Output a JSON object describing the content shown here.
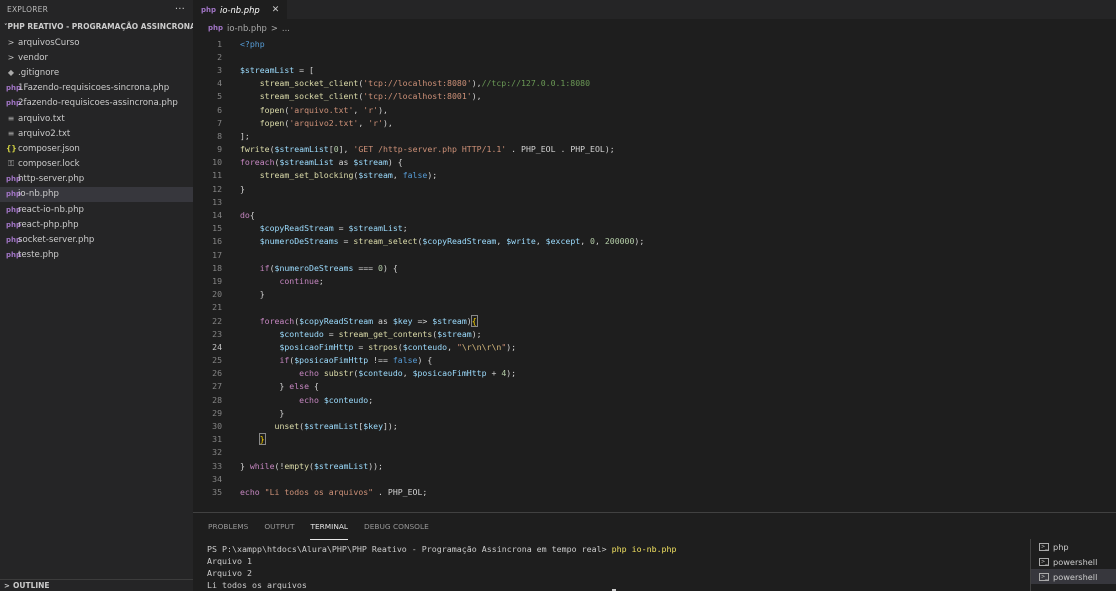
{
  "sidebar": {
    "header": "EXPLORER",
    "more_glyph": "···",
    "project": "PHP REATIVO - PROGRAMAÇÃO ASSINCRONA E...",
    "items": [
      {
        "label": "arquivosCurso",
        "icon": "chevron-right-icon",
        "glyph": ">"
      },
      {
        "label": "vendor",
        "icon": "chevron-right-icon",
        "glyph": ">"
      },
      {
        "label": ".gitignore",
        "icon": "git-file-icon",
        "glyph": "◆"
      },
      {
        "label": "1Fazendo-requisicoes-sincrona.php",
        "icon": "php-file-icon",
        "glyph": "php"
      },
      {
        "label": "2fazendo-requisicoes-assincrona.php",
        "icon": "php-file-icon",
        "glyph": "php"
      },
      {
        "label": "arquivo.txt",
        "icon": "text-file-icon",
        "glyph": "≡"
      },
      {
        "label": "arquivo2.txt",
        "icon": "text-file-icon",
        "glyph": "≡"
      },
      {
        "label": "composer.json",
        "icon": "json-file-icon",
        "glyph": "{}"
      },
      {
        "label": "composer.lock",
        "icon": "lock-file-icon",
        "glyph": "⚿"
      },
      {
        "label": "http-server.php",
        "icon": "php-file-icon",
        "glyph": "php"
      },
      {
        "label": "io-nb.php",
        "icon": "php-file-icon",
        "glyph": "php"
      },
      {
        "label": "react-io-nb.php",
        "icon": "php-file-icon",
        "glyph": "php"
      },
      {
        "label": "react-php.php",
        "icon": "php-file-icon",
        "glyph": "php"
      },
      {
        "label": "socket-server.php",
        "icon": "php-file-icon",
        "glyph": "php"
      },
      {
        "label": "teste.php",
        "icon": "php-file-icon",
        "glyph": "php"
      }
    ],
    "active_index": 10,
    "outline": "OUTLINE"
  },
  "editor": {
    "tab": {
      "label": "io-nb.php",
      "close": "✕"
    },
    "breadcrumb": {
      "file": "io-nb.php",
      "sep": ">",
      "rest": "..."
    },
    "current_line": 24,
    "lines": [
      [
        {
          "c": "t-tag",
          "t": "<?php"
        }
      ],
      [],
      [
        {
          "c": "t-var",
          "t": "$streamList"
        },
        {
          "c": "t-op",
          "t": " = ["
        }
      ],
      [
        {
          "c": "t-plain",
          "t": "    "
        },
        {
          "c": "t-fn",
          "t": "stream_socket_client"
        },
        {
          "c": "t-plain",
          "t": "("
        },
        {
          "c": "t-str",
          "t": "'tcp://localhost:8080'"
        },
        {
          "c": "t-plain",
          "t": "),"
        },
        {
          "c": "t-cm",
          "t": "//tcp://127.0.0.1:8080"
        }
      ],
      [
        {
          "c": "t-plain",
          "t": "    "
        },
        {
          "c": "t-fn",
          "t": "stream_socket_client"
        },
        {
          "c": "t-plain",
          "t": "("
        },
        {
          "c": "t-str",
          "t": "'tcp://localhost:8001'"
        },
        {
          "c": "t-plain",
          "t": "),"
        }
      ],
      [
        {
          "c": "t-plain",
          "t": "    "
        },
        {
          "c": "t-fn",
          "t": "fopen"
        },
        {
          "c": "t-plain",
          "t": "("
        },
        {
          "c": "t-str",
          "t": "'arquivo.txt'"
        },
        {
          "c": "t-plain",
          "t": ", "
        },
        {
          "c": "t-str",
          "t": "'r'"
        },
        {
          "c": "t-plain",
          "t": "),"
        }
      ],
      [
        {
          "c": "t-plain",
          "t": "    "
        },
        {
          "c": "t-fn",
          "t": "fopen"
        },
        {
          "c": "t-plain",
          "t": "("
        },
        {
          "c": "t-str",
          "t": "'arquivo2.txt'"
        },
        {
          "c": "t-plain",
          "t": ", "
        },
        {
          "c": "t-str",
          "t": "'r'"
        },
        {
          "c": "t-plain",
          "t": "),"
        }
      ],
      [
        {
          "c": "t-plain",
          "t": "];"
        }
      ],
      [
        {
          "c": "t-fn",
          "t": "fwrite"
        },
        {
          "c": "t-plain",
          "t": "("
        },
        {
          "c": "t-var",
          "t": "$streamList"
        },
        {
          "c": "t-plain",
          "t": "["
        },
        {
          "c": "t-num",
          "t": "0"
        },
        {
          "c": "t-plain",
          "t": "], "
        },
        {
          "c": "t-str",
          "t": "'GET /http-server.php HTTP/1.1'"
        },
        {
          "c": "t-plain",
          "t": " . PHP_EOL . PHP_EOL);"
        }
      ],
      [
        {
          "c": "t-kw",
          "t": "foreach"
        },
        {
          "c": "t-plain",
          "t": "("
        },
        {
          "c": "t-var",
          "t": "$streamList"
        },
        {
          "c": "t-plain",
          "t": " as "
        },
        {
          "c": "t-var",
          "t": "$stream"
        },
        {
          "c": "t-plain",
          "t": ") {"
        }
      ],
      [
        {
          "c": "t-plain",
          "t": "    "
        },
        {
          "c": "t-fn",
          "t": "stream_set_blocking"
        },
        {
          "c": "t-plain",
          "t": "("
        },
        {
          "c": "t-var",
          "t": "$stream"
        },
        {
          "c": "t-plain",
          "t": ", "
        },
        {
          "c": "t-const",
          "t": "false"
        },
        {
          "c": "t-plain",
          "t": ");"
        }
      ],
      [
        {
          "c": "t-plain",
          "t": "}"
        }
      ],
      [],
      [
        {
          "c": "t-kw",
          "t": "do"
        },
        {
          "c": "t-plain",
          "t": "{"
        }
      ],
      [
        {
          "c": "t-plain",
          "t": "    "
        },
        {
          "c": "t-var",
          "t": "$copyReadStream"
        },
        {
          "c": "t-plain",
          "t": " = "
        },
        {
          "c": "t-var",
          "t": "$streamList"
        },
        {
          "c": "t-plain",
          "t": ";"
        }
      ],
      [
        {
          "c": "t-plain",
          "t": "    "
        },
        {
          "c": "t-var",
          "t": "$numeroDeStreams"
        },
        {
          "c": "t-plain",
          "t": " = "
        },
        {
          "c": "t-fn",
          "t": "stream_select"
        },
        {
          "c": "t-plain",
          "t": "("
        },
        {
          "c": "t-var",
          "t": "$copyReadStream"
        },
        {
          "c": "t-plain",
          "t": ", "
        },
        {
          "c": "t-var",
          "t": "$write"
        },
        {
          "c": "t-plain",
          "t": ", "
        },
        {
          "c": "t-var",
          "t": "$except"
        },
        {
          "c": "t-plain",
          "t": ", "
        },
        {
          "c": "t-num",
          "t": "0"
        },
        {
          "c": "t-plain",
          "t": ", "
        },
        {
          "c": "t-num",
          "t": "200000"
        },
        {
          "c": "t-plain",
          "t": ");"
        }
      ],
      [],
      [
        {
          "c": "t-plain",
          "t": "    "
        },
        {
          "c": "t-kw",
          "t": "if"
        },
        {
          "c": "t-plain",
          "t": "("
        },
        {
          "c": "t-var",
          "t": "$numeroDeStreams"
        },
        {
          "c": "t-plain",
          "t": " === "
        },
        {
          "c": "t-num",
          "t": "0"
        },
        {
          "c": "t-plain",
          "t": ") {"
        }
      ],
      [
        {
          "c": "t-plain",
          "t": "        "
        },
        {
          "c": "t-kw",
          "t": "continue"
        },
        {
          "c": "t-plain",
          "t": ";"
        }
      ],
      [
        {
          "c": "t-plain",
          "t": "    }"
        }
      ],
      [],
      [
        {
          "c": "t-plain",
          "t": "    "
        },
        {
          "c": "t-kw",
          "t": "foreach"
        },
        {
          "c": "t-plain",
          "t": "("
        },
        {
          "c": "t-var",
          "t": "$copyReadStream"
        },
        {
          "c": "t-plain",
          "t": " as "
        },
        {
          "c": "t-var",
          "t": "$key"
        },
        {
          "c": "t-plain",
          "t": " => "
        },
        {
          "c": "t-var",
          "t": "$stream"
        },
        {
          "c": "t-plain",
          "t": ")"
        },
        {
          "c": "t-br",
          "t": "{"
        }
      ],
      [
        {
          "c": "t-plain",
          "t": "        "
        },
        {
          "c": "t-var",
          "t": "$conteudo"
        },
        {
          "c": "t-plain",
          "t": " = "
        },
        {
          "c": "t-fn",
          "t": "stream_get_contents"
        },
        {
          "c": "t-plain",
          "t": "("
        },
        {
          "c": "t-var",
          "t": "$stream"
        },
        {
          "c": "t-plain",
          "t": ");"
        }
      ],
      [
        {
          "c": "t-plain",
          "t": "        "
        },
        {
          "c": "t-var",
          "t": "$posicaoFimHttp"
        },
        {
          "c": "t-plain",
          "t": " = "
        },
        {
          "c": "t-fn",
          "t": "strpos"
        },
        {
          "c": "t-plain",
          "t": "("
        },
        {
          "c": "t-var",
          "t": "$conteudo"
        },
        {
          "c": "t-plain",
          "t": ", "
        },
        {
          "c": "t-str",
          "t": "\""
        },
        {
          "c": "t-esc",
          "t": "\\r\\n\\r\\n"
        },
        {
          "c": "t-str",
          "t": "\""
        },
        {
          "c": "t-plain",
          "t": ");"
        }
      ],
      [
        {
          "c": "t-plain",
          "t": "        "
        },
        {
          "c": "t-kw",
          "t": "if"
        },
        {
          "c": "t-plain",
          "t": "("
        },
        {
          "c": "t-var",
          "t": "$posicaoFimHttp"
        },
        {
          "c": "t-plain",
          "t": " !== "
        },
        {
          "c": "t-const",
          "t": "false"
        },
        {
          "c": "t-plain",
          "t": ") {"
        }
      ],
      [
        {
          "c": "t-plain",
          "t": "            "
        },
        {
          "c": "t-kw",
          "t": "echo"
        },
        {
          "c": "t-plain",
          "t": " "
        },
        {
          "c": "t-fn",
          "t": "substr"
        },
        {
          "c": "t-plain",
          "t": "("
        },
        {
          "c": "t-var",
          "t": "$conteudo"
        },
        {
          "c": "t-plain",
          "t": ", "
        },
        {
          "c": "t-var",
          "t": "$posicaoFimHttp"
        },
        {
          "c": "t-plain",
          "t": " + "
        },
        {
          "c": "t-num",
          "t": "4"
        },
        {
          "c": "t-plain",
          "t": ");"
        }
      ],
      [
        {
          "c": "t-plain",
          "t": "        } "
        },
        {
          "c": "t-kw",
          "t": "else"
        },
        {
          "c": "t-plain",
          "t": " {"
        }
      ],
      [
        {
          "c": "t-plain",
          "t": "            "
        },
        {
          "c": "t-kw",
          "t": "echo"
        },
        {
          "c": "t-plain",
          "t": " "
        },
        {
          "c": "t-var",
          "t": "$conteudo"
        },
        {
          "c": "t-plain",
          "t": ";"
        }
      ],
      [
        {
          "c": "t-plain",
          "t": "        }"
        }
      ],
      [
        {
          "c": "t-plain",
          "t": "       "
        },
        {
          "c": "t-fn",
          "t": "unset"
        },
        {
          "c": "t-plain",
          "t": "("
        },
        {
          "c": "t-var",
          "t": "$streamList"
        },
        {
          "c": "t-plain",
          "t": "["
        },
        {
          "c": "t-var",
          "t": "$key"
        },
        {
          "c": "t-plain",
          "t": "]);"
        }
      ],
      [
        {
          "c": "t-plain",
          "t": "    "
        },
        {
          "c": "t-br",
          "t": "}"
        }
      ],
      [],
      [
        {
          "c": "t-plain",
          "t": "} "
        },
        {
          "c": "t-kw",
          "t": "while"
        },
        {
          "c": "t-plain",
          "t": "(!"
        },
        {
          "c": "t-fn",
          "t": "empty"
        },
        {
          "c": "t-plain",
          "t": "("
        },
        {
          "c": "t-var",
          "t": "$streamList"
        },
        {
          "c": "t-plain",
          "t": "));"
        }
      ],
      [],
      [
        {
          "c": "t-kw",
          "t": "echo"
        },
        {
          "c": "t-plain",
          "t": " "
        },
        {
          "c": "t-str",
          "t": "\"Li todos os arquivos\""
        },
        {
          "c": "t-plain",
          "t": " . PHP_EOL;"
        }
      ]
    ]
  },
  "panel": {
    "tabs": [
      "PROBLEMS",
      "OUTPUT",
      "TERMINAL",
      "DEBUG CONSOLE"
    ],
    "active_tab": 2,
    "terminal": {
      "prompt": "PS P:\\xampp\\htdocs\\Alura\\PHP\\PHP Reativo - Programação Assincrona em tempo real> ",
      "command": "php io-nb.php",
      "output": [
        "Arquivo 1",
        "Arquivo 2",
        "Li todos os arquivos"
      ]
    },
    "terminals": [
      "php",
      "powershell",
      "powershell"
    ],
    "active_terminal": 2,
    "terminal_icon_glyph": ">_"
  },
  "colors": {
    "background": "#1e1e1e",
    "sidebar": "#252526",
    "selection": "#37373d",
    "php_icon": "#a074c4"
  }
}
